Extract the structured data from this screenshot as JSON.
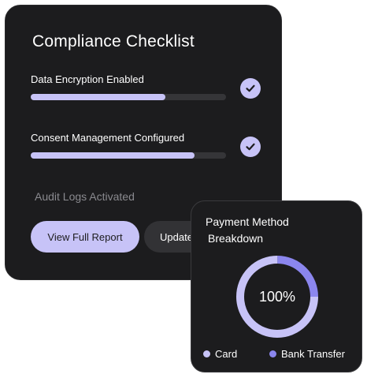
{
  "compliance": {
    "title": "Compliance Checklist",
    "items": [
      {
        "label": "Data Encryption Enabled",
        "progress": 0.69,
        "completed": true,
        "check_icon": "check-icon"
      },
      {
        "label": "Consent Management Configured",
        "progress": 0.84,
        "completed": true,
        "check_icon": "check-icon"
      },
      {
        "label": "Audit Logs Activated",
        "completed": false
      }
    ],
    "view_report_label": "View Full Report",
    "update_label": "Update"
  },
  "payment": {
    "title_line1": "Payment Method",
    "title_line2": "Breakdown",
    "center_label": "100%",
    "legend": [
      {
        "label": "Card",
        "color": "#c7c3f7"
      },
      {
        "label": "Bank Transfer",
        "color": "#8b86ee"
      }
    ]
  },
  "chart_data": {
    "type": "pie",
    "categories": [
      "Card",
      "Bank Transfer"
    ],
    "values": [
      75,
      25
    ],
    "colors": [
      "#c7c3f7",
      "#8b86ee"
    ],
    "center_label": "100%",
    "legend_position": "bottom"
  },
  "colors": {
    "card_background": "#1c1c1e",
    "accent": "#c7c3f7",
    "accent_secondary": "#8b86ee",
    "track": "#353538"
  }
}
